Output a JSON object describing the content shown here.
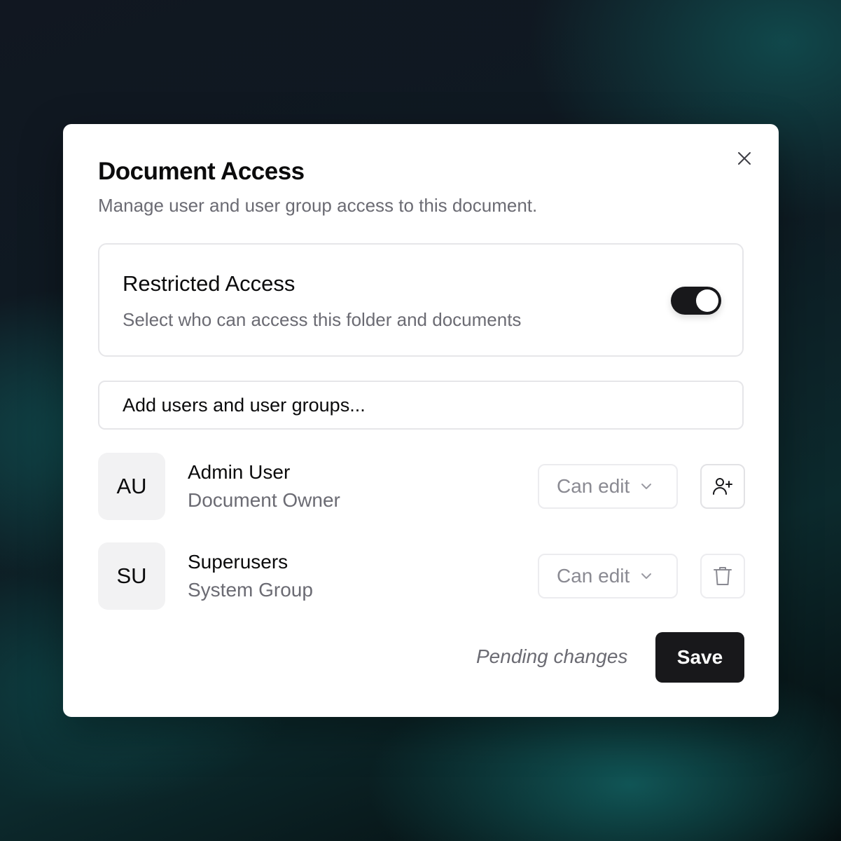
{
  "dialog": {
    "title": "Document Access",
    "subtitle": "Manage user and user group access to this document.",
    "close_icon": "close-icon"
  },
  "restricted": {
    "title": "Restricted Access",
    "description": "Select who can access this folder and documents",
    "enabled": true
  },
  "search": {
    "placeholder": "Add users and user groups..."
  },
  "members": [
    {
      "initials": "AU",
      "name": "Admin User",
      "role": "Document Owner",
      "permission": "Can edit",
      "action_icon": "user-plus-icon"
    },
    {
      "initials": "SU",
      "name": "Superusers",
      "role": "System Group",
      "permission": "Can edit",
      "action_icon": "trash-icon"
    }
  ],
  "footer": {
    "status": "Pending changes",
    "save_label": "Save"
  },
  "colors": {
    "primary": "#18181b",
    "muted_text": "#6b6b73",
    "border": "#e6e6e9"
  }
}
